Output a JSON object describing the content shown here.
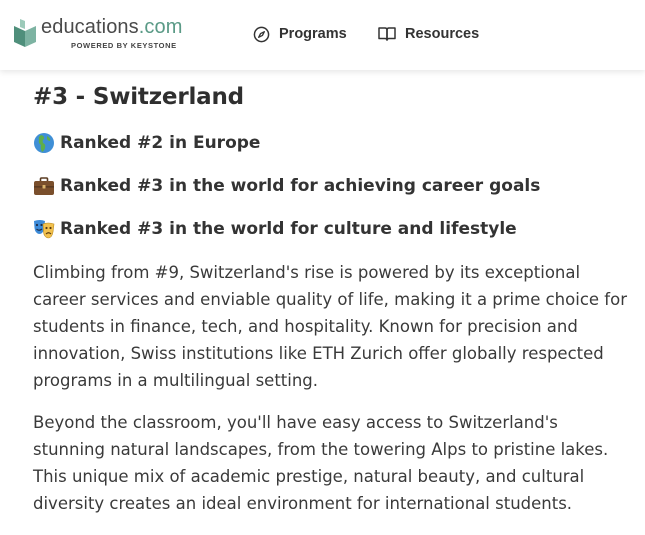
{
  "header": {
    "logo": {
      "name": "educations",
      "suffix": ".com",
      "tagline": "POWERED BY KEYSTONE"
    },
    "nav": [
      {
        "label": "Programs",
        "icon": "compass-icon"
      },
      {
        "label": "Resources",
        "icon": "book-open-icon"
      }
    ]
  },
  "article": {
    "title": "#3 - Switzerland",
    "rankings": [
      {
        "emoji": "globe-europe-africa-icon",
        "text": "Ranked #2 in Europe"
      },
      {
        "emoji": "briefcase-icon",
        "text": "Ranked #3 in the world for achieving career goals"
      },
      {
        "emoji": "performing-arts-icon",
        "text": "Ranked #3 in the world for culture and lifestyle"
      }
    ],
    "paragraphs": [
      "Climbing from #9, Switzerland's rise is powered by its exceptional\ncareer services and enviable quality of life, making it a prime choice for\nstudents in finance, tech, and hospitality. Known for precision and\ninnovation, Swiss institutions like ETH Zurich offer globally respected\nprograms in a multilingual setting.",
      "Beyond the classroom, you'll have easy access to Switzerland's\nstunning natural landscapes, from the towering Alps to pristine lakes.\nThis unique mix of academic prestige, natural beauty, and cultural\ndiversity creates an ideal environment for international students."
    ]
  },
  "colors": {
    "brand_teal": "#5a9a86",
    "text": "#3a3a3a"
  }
}
